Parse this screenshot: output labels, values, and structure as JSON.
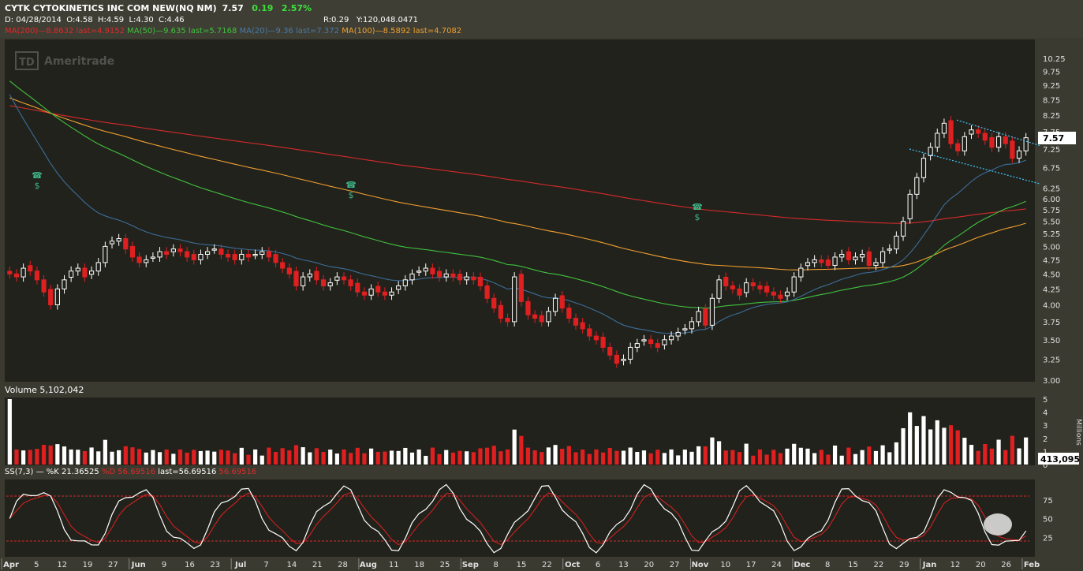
{
  "header": {
    "symbol_line": "CYTK CYTOKINETICS INC COM NEW(NQ NM)",
    "last": "7.57",
    "change": "0.19",
    "change_pct": "2.57%",
    "date": "D: 04/28/2014",
    "open": "O:4.58",
    "high": "H:4.59",
    "low": "L:4.30",
    "close": "C:4.46",
    "range": "R:0.29",
    "y": "Y:120,048.0471",
    "ma200_label": "MA(200)",
    "ma200_vals": "8.8632 last=4.9152",
    "ma50_label": "MA(50)",
    "ma50_vals": "9.635 last=5.7168",
    "ma20_label": "MA(20)",
    "ma20_vals": "9.36 last=7.372",
    "ma100_label": "MA(100)",
    "ma100_vals": "8.5892 last=4.7082"
  },
  "watermark": "Ameritrade",
  "watermark_badge": "TD",
  "volume_label": "Volume 5,102,042",
  "volume_last": "413,095",
  "volume_unit": "Millions",
  "ss_label": "SS(7,3)",
  "ss_k": "%K 21.36525",
  "ss_d_label": "%D 56.69516",
  "ss_last": "last=56.69516",
  "ss_extra": "56.69516",
  "price_last_label": "7.57",
  "chart_data": [
    {
      "type": "candlestick",
      "price_ticks": [
        "10.25",
        "9.75",
        "9.25",
        "8.75",
        "8.25",
        "7.75",
        "7.25",
        "6.75",
        "6.25",
        "6.00",
        "5.75",
        "5.50",
        "5.25",
        "5.00",
        "4.75",
        "4.50",
        "4.25",
        "4.00",
        "3.75",
        "3.50",
        "3.25",
        "3.00"
      ],
      "ylim": [
        3.0,
        10.25
      ],
      "scale": "log",
      "x_ticks": [
        "Apr",
        "5",
        "12",
        "19",
        "27",
        "Jun",
        "9",
        "16",
        "23",
        "Jul",
        "7",
        "14",
        "21",
        "28",
        "Aug",
        "11",
        "18",
        "25",
        "Sep",
        "8",
        "15",
        "22",
        "Oct",
        "6",
        "13",
        "20",
        "27",
        "Nov",
        "10",
        "17",
        "24",
        "Dec",
        "8",
        "15",
        "22",
        "29",
        "Jan",
        "12",
        "20",
        "26",
        "Feb"
      ],
      "last_price": 7.57,
      "series_close": [
        4.5,
        4.45,
        4.6,
        4.55,
        4.4,
        4.2,
        4.0,
        4.25,
        4.4,
        4.55,
        4.6,
        4.45,
        4.55,
        4.7,
        5.0,
        5.1,
        5.15,
        4.95,
        4.8,
        4.7,
        4.75,
        4.8,
        4.9,
        4.85,
        4.95,
        4.9,
        4.8,
        4.75,
        4.85,
        4.9,
        4.95,
        4.85,
        4.8,
        4.75,
        4.85,
        4.8,
        4.85,
        4.9,
        4.8,
        4.7,
        4.6,
        4.5,
        4.3,
        4.45,
        4.5,
        4.4,
        4.3,
        4.35,
        4.45,
        4.4,
        4.3,
        4.2,
        4.15,
        4.25,
        4.2,
        4.15,
        4.2,
        4.3,
        4.4,
        4.5,
        4.55,
        4.6,
        4.5,
        4.45,
        4.5,
        4.45,
        4.4,
        4.45,
        4.4,
        4.3,
        4.1,
        3.95,
        3.8,
        3.75,
        4.45,
        4.05,
        3.85,
        3.8,
        3.75,
        3.9,
        4.1,
        3.95,
        3.8,
        3.7,
        3.65,
        3.55,
        3.5,
        3.4,
        3.3,
        3.2,
        3.25,
        3.4,
        3.45,
        3.5,
        3.45,
        3.4,
        3.5,
        3.55,
        3.6,
        3.65,
        3.75,
        3.9,
        3.7,
        4.1,
        4.4,
        4.3,
        4.25,
        4.15,
        4.35,
        4.3,
        4.25,
        4.2,
        4.15,
        4.1,
        4.2,
        4.45,
        4.6,
        4.7,
        4.75,
        4.7,
        4.65,
        4.8,
        4.85,
        4.75,
        4.8,
        4.85,
        4.65,
        4.7,
        4.9,
        4.95,
        5.2,
        5.5,
        6.1,
        6.5,
        7.0,
        7.3,
        7.7,
        8.0,
        7.4,
        7.2,
        7.6,
        7.8,
        7.7,
        7.5,
        7.3,
        7.6,
        7.4,
        7.0,
        7.2,
        7.57
      ],
      "volume_millions_ylim": [
        0,
        5
      ],
      "volume_ticks": [
        "5",
        "4",
        "3",
        "2",
        "1",
        "0"
      ],
      "stoch_ticks": [
        "75",
        "50",
        "25"
      ],
      "stoch_ylim": [
        0,
        100
      ],
      "stoch_bands": [
        80,
        20
      ]
    }
  ]
}
